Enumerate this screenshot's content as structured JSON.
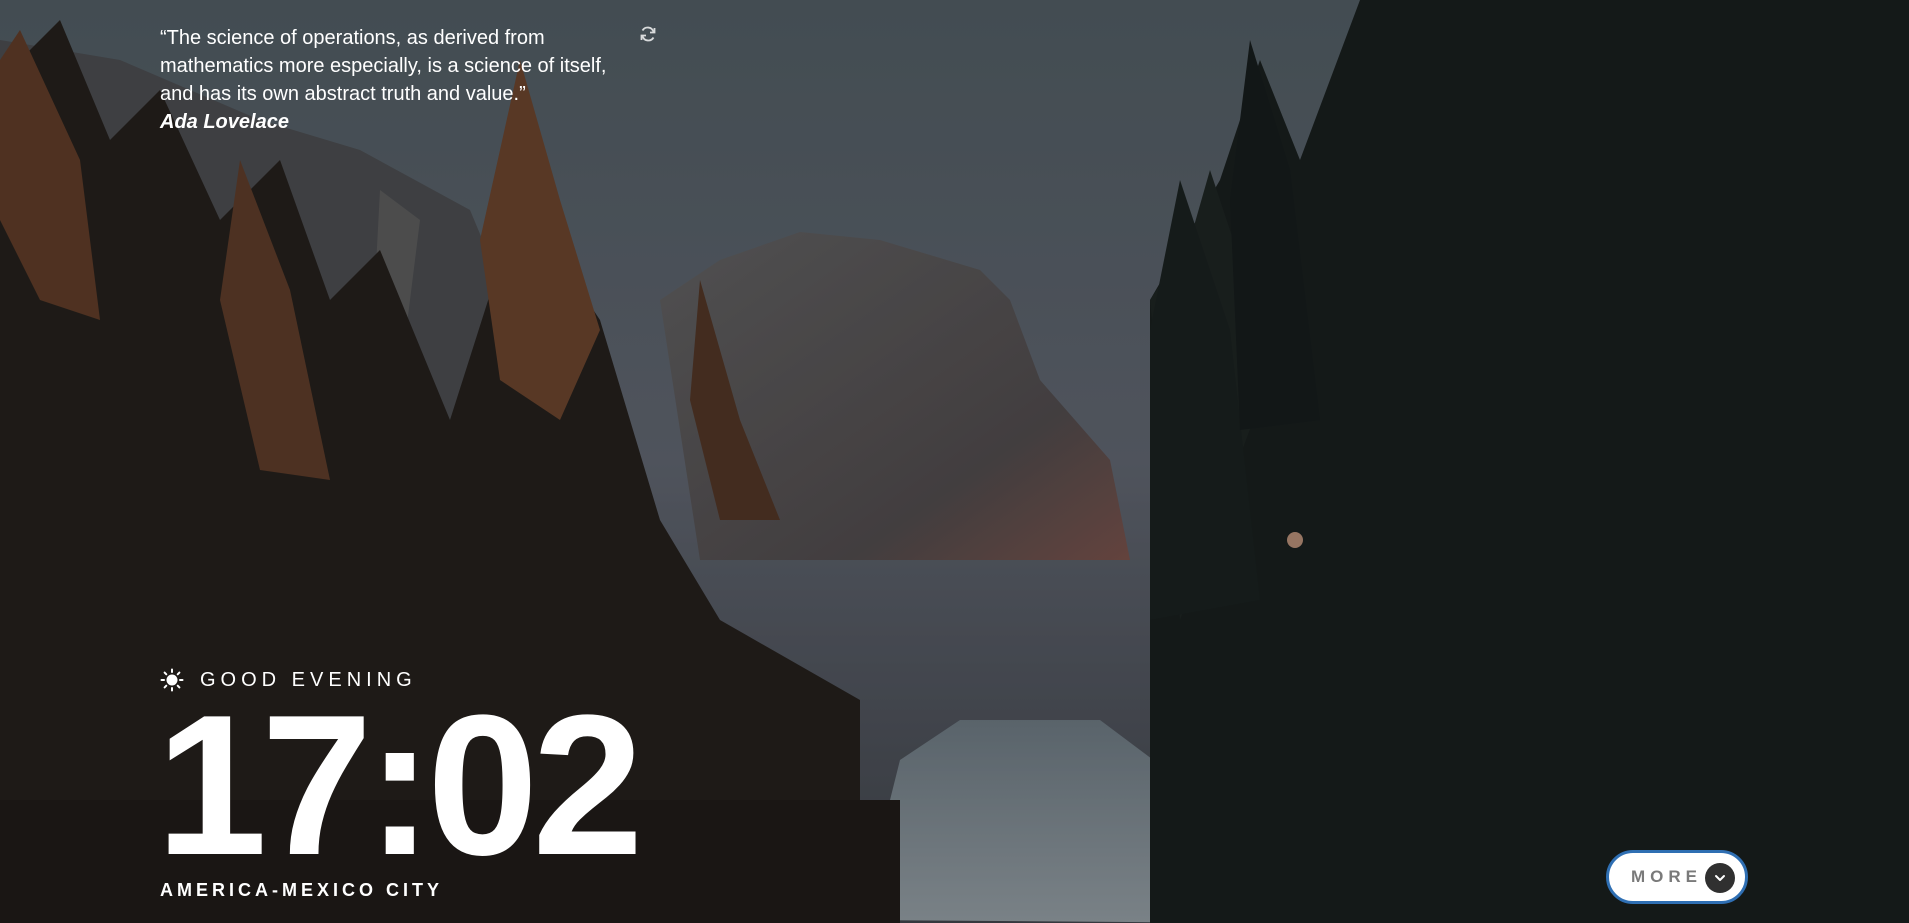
{
  "quote": {
    "text": "“The science of operations, as derived from mathematics more especially, is a science of itself, and has its own abstract truth and value.”",
    "author": "Ada Lovelace",
    "refresh_icon": "refresh-icon"
  },
  "clock": {
    "greeting": "GOOD EVENING",
    "greeting_icon": "sun-icon",
    "time": "17:02",
    "location": "AMERICA-MEXICO CITY"
  },
  "more_button": {
    "label": "MORE",
    "icon": "chevron-down-icon"
  },
  "colors": {
    "text": "#ffffff",
    "button_bg": "#ffffff",
    "button_border": "#2f6fb3",
    "button_label": "#7a7a7a",
    "chevron_bg": "#303030"
  }
}
